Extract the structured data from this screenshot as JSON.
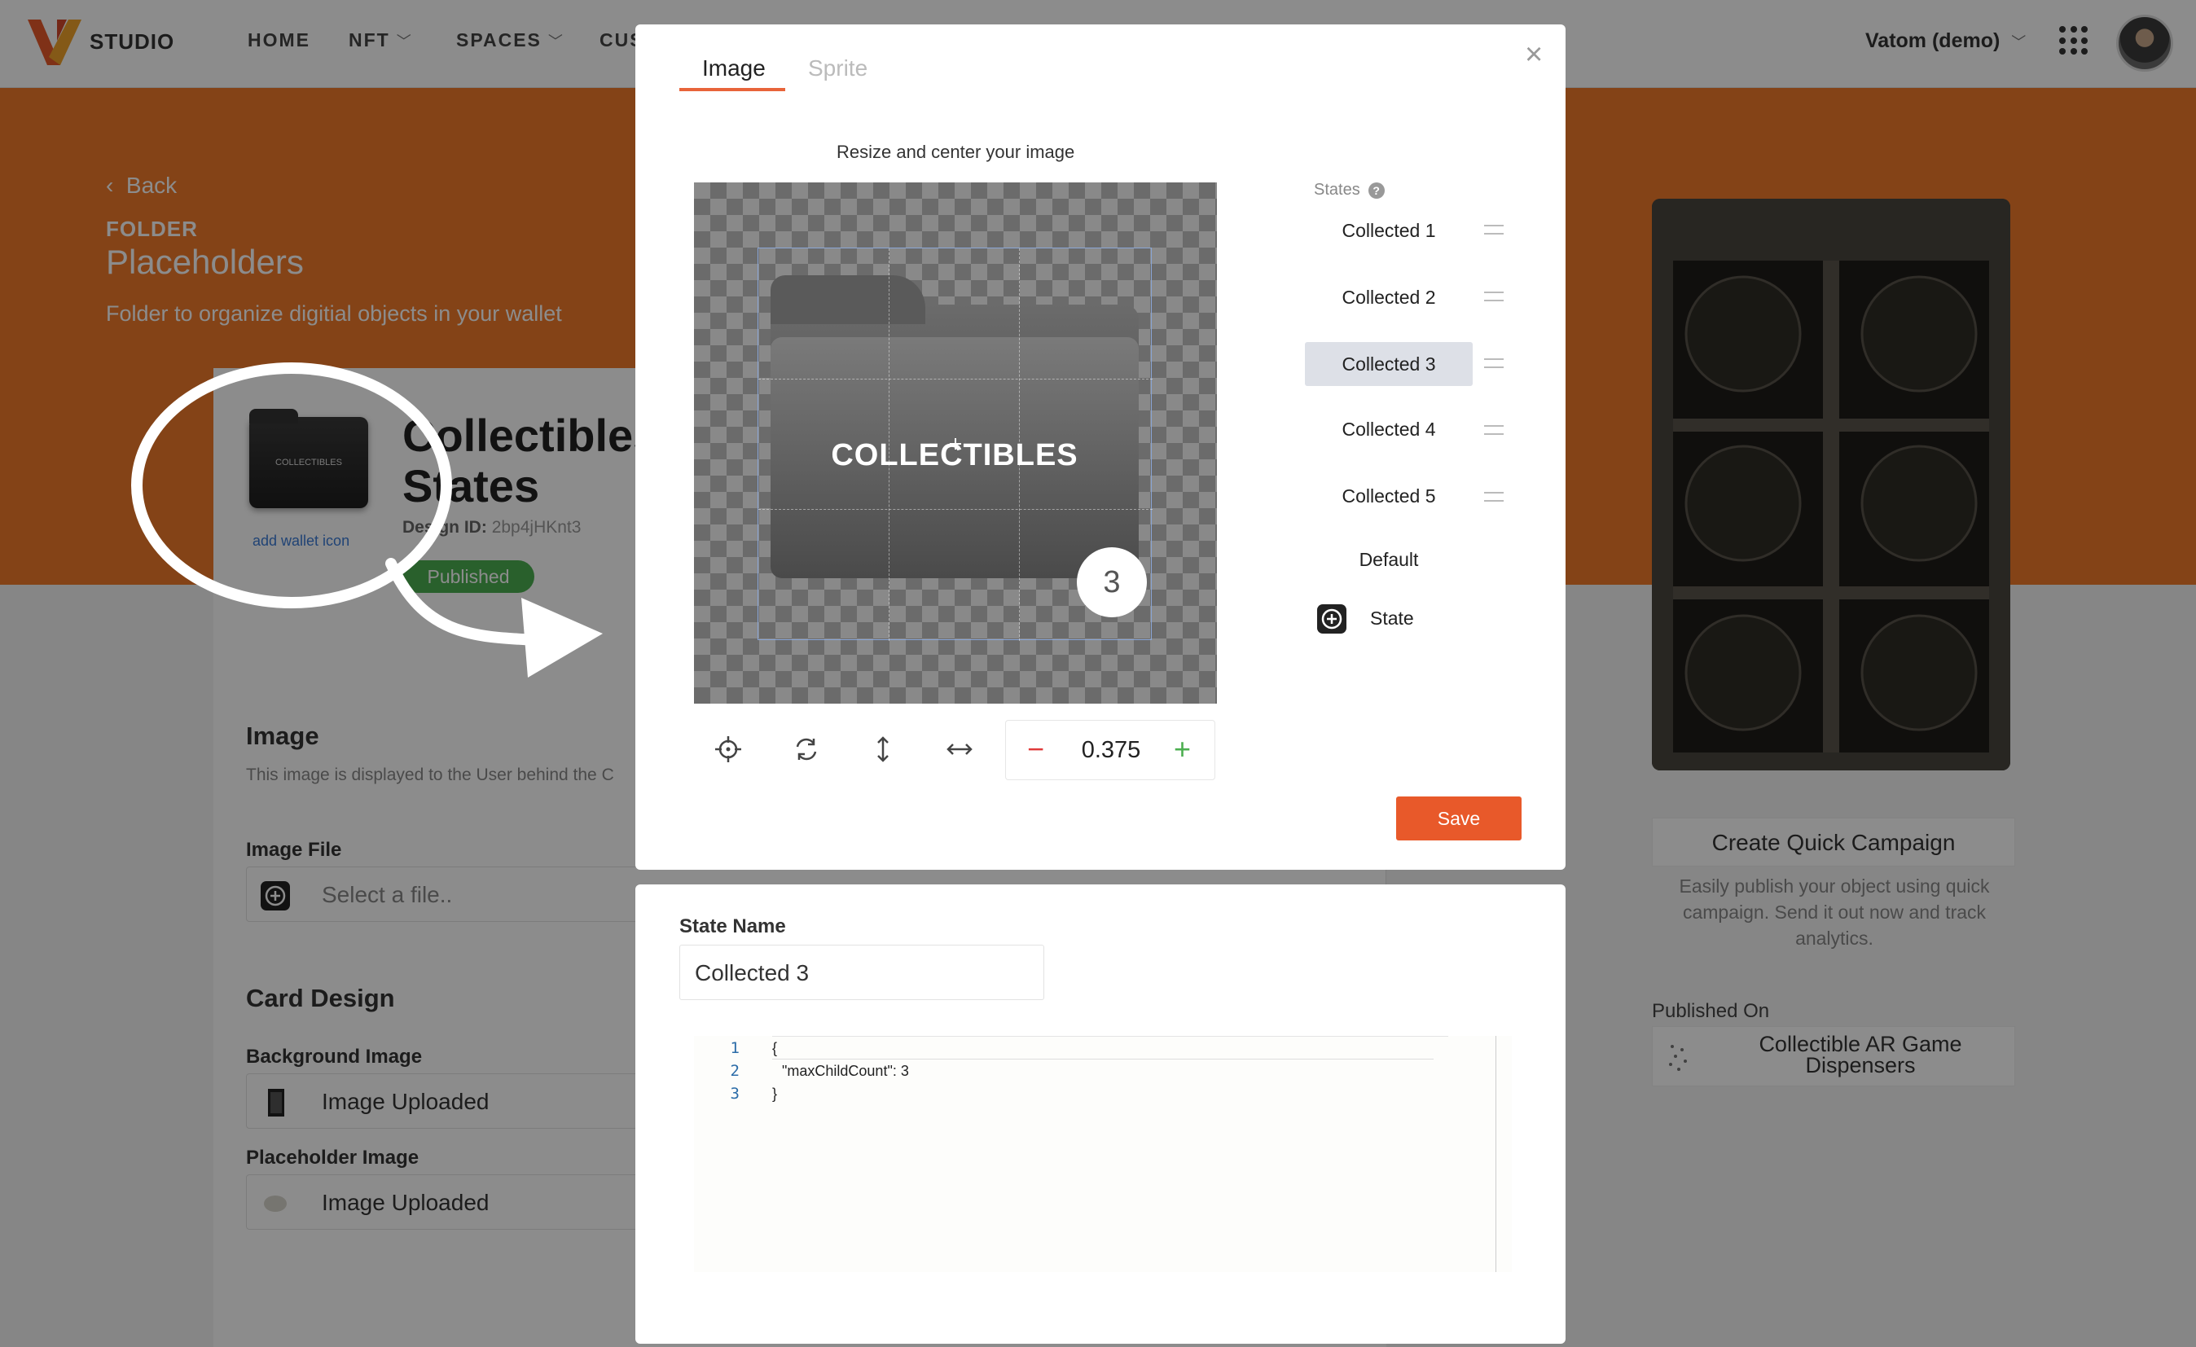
{
  "header": {
    "brand": "STUDIO",
    "nav": [
      "HOME",
      "NFT",
      "SPACES",
      "CUS"
    ],
    "user": "Vatom (demo)"
  },
  "hero": {
    "back": "Back",
    "folder_label": "FOLDER",
    "folder_title": "Placeholders",
    "folder_desc": "Folder to organize digitial objects in your wallet"
  },
  "card": {
    "wallet_thumb_text": "COLLECTIBLES",
    "add_wallet": "add wallet icon",
    "title_line1": "Collectibles",
    "title_line2": "States",
    "design_id_label": "Design ID:",
    "design_id": "2bp4jHKnt3",
    "status": "Published",
    "image_section": "Image",
    "image_desc": "This image is displayed to the User behind the C",
    "image_file_label": "Image File",
    "image_file_placeholder": "Select a file..",
    "card_design": "Card Design",
    "bg_image_label": "Background Image",
    "bg_image_value": "Image Uploaded",
    "placeholder_label": "Placeholder Image",
    "placeholder_value": "Image Uploaded"
  },
  "right": {
    "cq_title": "Create Quick Campaign",
    "cq_desc": "Easily publish your object using quick campaign. Send it out now and track analytics.",
    "published_on": "Published On",
    "published_name": "Collectible AR Game Dispensers"
  },
  "modal": {
    "tabs": [
      "Image",
      "Sprite"
    ],
    "active_tab": "Image",
    "resize_label": "Resize and center your image",
    "canvas_text": "COLLECTIBLES",
    "badge": "3",
    "zoom": "0.375",
    "zoom_minus": "−",
    "zoom_plus": "+",
    "states_label": "States",
    "states": [
      "Collected 1",
      "Collected 2",
      "Collected 3",
      "Collected 4",
      "Collected 5",
      "Default"
    ],
    "selected_state": "Collected 3",
    "add_state": "State",
    "save": "Save",
    "close": "×"
  },
  "lower": {
    "state_name_label": "State Name",
    "state_name_value": "Collected 3",
    "code_lines": [
      "{",
      "\"maxChildCount\": 3",
      "}"
    ],
    "line_numbers": [
      "1",
      "2",
      "3"
    ]
  },
  "colors": {
    "accent": "#f07a2a",
    "save": "#e8592a",
    "published": "#4caf50",
    "selected_state": "#dde0e7"
  },
  "icons": [
    "chevron-left-icon",
    "apps-grid-icon",
    "plus-square-icon",
    "crosshair-icon",
    "refresh-icon",
    "vertical-arrows-icon",
    "horizontal-arrows-icon",
    "help-icon",
    "drag-handle-icon",
    "close-icon"
  ]
}
